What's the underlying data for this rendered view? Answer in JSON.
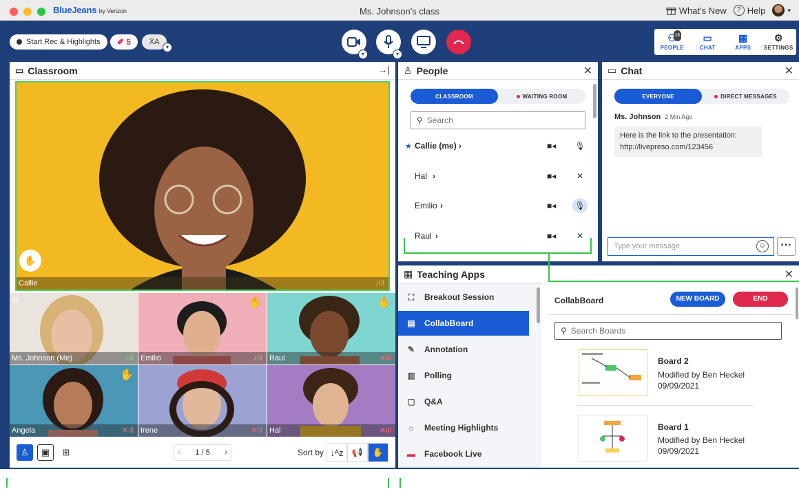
{
  "window": {
    "brand": "BlueJeans",
    "brand_by": "by Verizon",
    "title": "Ms. Johnson's class",
    "whats_new": "What's New",
    "help": "Help"
  },
  "toolbar": {
    "record_label": "Start Rec & Highlights",
    "highlights_count": "5",
    "translate_label": "X̄A",
    "people_count": "15",
    "tools": [
      {
        "label": "PEOPLE",
        "icon": "people-icon"
      },
      {
        "label": "CHAT",
        "icon": "chat-icon"
      },
      {
        "label": "APPS",
        "icon": "apps-icon"
      },
      {
        "label": "SETTINGS",
        "icon": "gear-icon"
      }
    ]
  },
  "classroom": {
    "title": "Classroom",
    "main_speaker": "Callie",
    "tiles": [
      {
        "name": "Ms. Johnson (Me)",
        "hand": false,
        "muted": false
      },
      {
        "name": "Emilio",
        "hand": true,
        "muted": false
      },
      {
        "name": "Raul",
        "hand": true,
        "muted": true
      },
      {
        "name": "Angela",
        "hand": true,
        "muted": true
      },
      {
        "name": "Irene",
        "hand": false,
        "muted": true
      },
      {
        "name": "Hal",
        "hand": false,
        "muted": true
      }
    ],
    "pager": "1 / 5",
    "sort_label": "Sort by"
  },
  "people": {
    "title": "People",
    "tabs": [
      "CLASSROOM",
      "WAITING ROOM"
    ],
    "search_placeholder": "Search",
    "rows": [
      {
        "name": "Callie (me)",
        "star": true,
        "mic": "on"
      },
      {
        "name": "Hal",
        "star": false,
        "mic": "muted"
      },
      {
        "name": "Emilio",
        "star": false,
        "mic": "active"
      },
      {
        "name": "Raul",
        "star": false,
        "mic": "muted"
      }
    ]
  },
  "chat": {
    "title": "Chat",
    "tabs": [
      "EVERYONE",
      "DIRECT MESSAGES"
    ],
    "author": "Ms. Johnson",
    "time": "2 Min Ago",
    "message_line1": "Here is the link to the presentation:",
    "message_line2": "http://livepreso.com/123456",
    "input_placeholder": "Type your message"
  },
  "apps": {
    "title": "Teaching Apps",
    "items": [
      {
        "label": "Breakout Session",
        "icon": "breakout-icon"
      },
      {
        "label": "CollabBoard",
        "icon": "board-icon"
      },
      {
        "label": "Annotation",
        "icon": "pen-icon"
      },
      {
        "label": "Polling",
        "icon": "poll-icon"
      },
      {
        "label": "Q&A",
        "icon": "qa-icon"
      },
      {
        "label": "Meeting Highlights",
        "icon": "bulb-icon"
      },
      {
        "label": "Facebook Live",
        "icon": "live-icon"
      }
    ],
    "selected": "CollabBoard"
  },
  "collabboard": {
    "title": "CollabBoard",
    "new_board": "NEW BOARD",
    "end": "END",
    "search_placeholder": "Search Boards",
    "boards": [
      {
        "name": "Board 2",
        "modified": "Modified by Ben Heckel",
        "date": "09/09/2021"
      },
      {
        "name": "Board 1",
        "modified": "Modified by Ben Heckel",
        "date": "09/09/2021"
      }
    ]
  },
  "colors": {
    "navy": "#1f3f7a",
    "blue": "#1a5bd6",
    "red": "#e0274e",
    "green": "#36c24a"
  }
}
